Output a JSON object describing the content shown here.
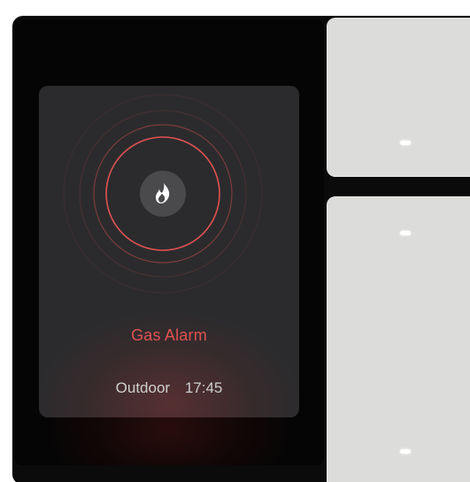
{
  "alarm": {
    "title": "Gas Alarm",
    "location": "Outdoor",
    "time": "17:45",
    "icon": "fire-icon",
    "accent_color": "#e05252"
  },
  "panels": {
    "top_button": {
      "indicator": "led-indicator"
    },
    "bottom_button": {
      "indicators": [
        "led-indicator",
        "led-indicator"
      ]
    }
  }
}
